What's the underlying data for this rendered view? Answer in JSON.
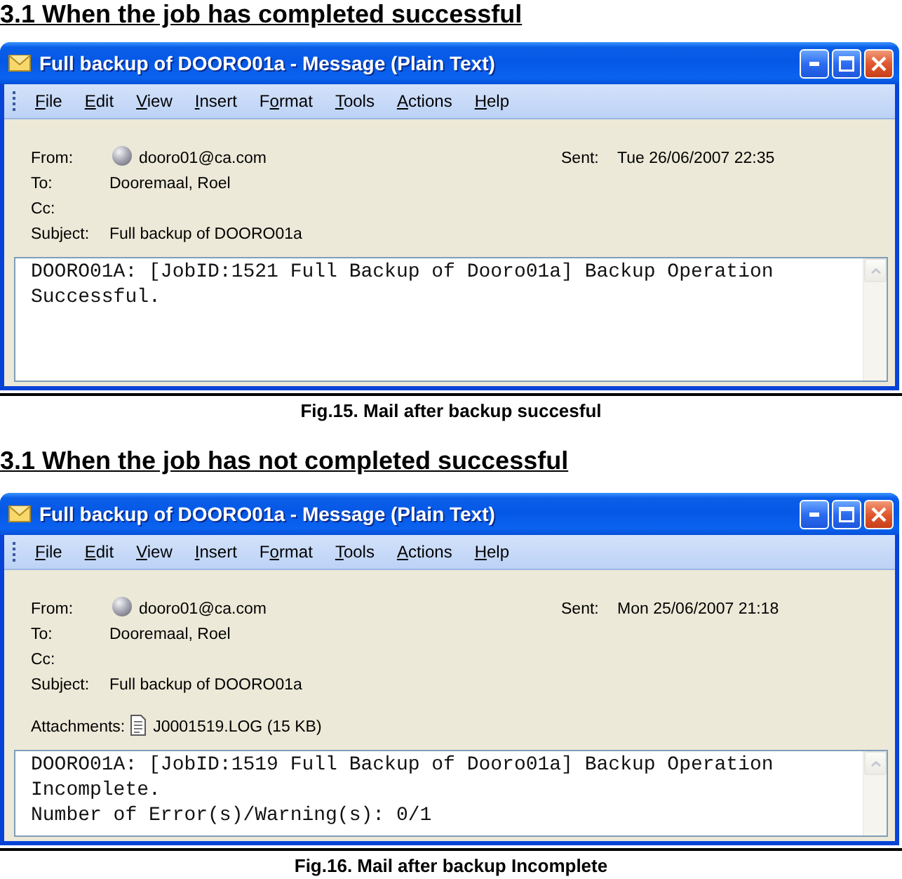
{
  "sections": [
    {
      "heading": "3.1 When the job has completed successful",
      "window": {
        "title": "Full backup of DOORO01a - Message (Plain Text)",
        "menu": [
          {
            "parts": [
              {
                "text": "F",
                "underlined": true
              },
              {
                "text": "ile",
                "underlined": false
              }
            ]
          },
          {
            "parts": [
              {
                "text": "E",
                "underlined": true
              },
              {
                "text": "dit",
                "underlined": false
              }
            ]
          },
          {
            "parts": [
              {
                "text": "V",
                "underlined": true
              },
              {
                "text": "iew",
                "underlined": false
              }
            ]
          },
          {
            "parts": [
              {
                "text": "I",
                "underlined": true
              },
              {
                "text": "nsert",
                "underlined": false
              }
            ]
          },
          {
            "parts": [
              {
                "text": "F",
                "underlined": false
              },
              {
                "text": "o",
                "underlined": true
              },
              {
                "text": "rmat",
                "underlined": false
              }
            ]
          },
          {
            "parts": [
              {
                "text": "T",
                "underlined": true
              },
              {
                "text": "ools",
                "underlined": false
              }
            ]
          },
          {
            "parts": [
              {
                "text": "A",
                "underlined": true
              },
              {
                "text": "ctions",
                "underlined": false
              }
            ]
          },
          {
            "parts": [
              {
                "text": "H",
                "underlined": true
              },
              {
                "text": "elp",
                "underlined": false
              }
            ]
          }
        ],
        "fields": [
          {
            "kind": "sender",
            "label": "From:",
            "value": "dooro01@ca.com"
          },
          {
            "kind": "text",
            "label": "To:",
            "value": "Dooremaal, Roel"
          },
          {
            "kind": "text",
            "label": "Cc:"
          },
          {
            "kind": "text",
            "label": "Subject:",
            "value": "Full backup of DOORO01a"
          }
        ],
        "sent": {
          "label": "Sent:",
          "value": "Tue 26/06/2007 22:35"
        },
        "body": [
          "DOORO01A: [JobID:1521 Full Backup of Dooro01a] Backup Operation Successful."
        ]
      },
      "caption": "Fig.15. Mail after backup succesful"
    },
    {
      "heading": "3.1 When the job has not completed successful",
      "window": {
        "title": "Full backup of DOORO01a - Message (Plain Text)",
        "menu": [
          {
            "parts": [
              {
                "text": "F",
                "underlined": true
              },
              {
                "text": "ile",
                "underlined": false
              }
            ]
          },
          {
            "parts": [
              {
                "text": "E",
                "underlined": true
              },
              {
                "text": "dit",
                "underlined": false
              }
            ]
          },
          {
            "parts": [
              {
                "text": "V",
                "underlined": true
              },
              {
                "text": "iew",
                "underlined": false
              }
            ]
          },
          {
            "parts": [
              {
                "text": "I",
                "underlined": true
              },
              {
                "text": "nsert",
                "underlined": false
              }
            ]
          },
          {
            "parts": [
              {
                "text": "F",
                "underlined": false
              },
              {
                "text": "o",
                "underlined": true
              },
              {
                "text": "rmat",
                "underlined": false
              }
            ]
          },
          {
            "parts": [
              {
                "text": "T",
                "underlined": true
              },
              {
                "text": "ools",
                "underlined": false
              }
            ]
          },
          {
            "parts": [
              {
                "text": "A",
                "underlined": true
              },
              {
                "text": "ctions",
                "underlined": false
              }
            ]
          },
          {
            "parts": [
              {
                "text": "H",
                "underlined": true
              },
              {
                "text": "elp",
                "underlined": false
              }
            ]
          }
        ],
        "fields": [
          {
            "kind": "sender",
            "label": "From:",
            "value": "dooro01@ca.com"
          },
          {
            "kind": "text",
            "label": "To:",
            "value": "Dooremaal, Roel"
          },
          {
            "kind": "text",
            "label": "Cc:"
          },
          {
            "kind": "text",
            "label": "Subject:",
            "value": "Full backup of DOORO01a"
          },
          {
            "kind": "attachment",
            "label": "Attachments:",
            "value": "J0001519.LOG (15 KB)"
          }
        ],
        "sent": {
          "label": "Sent:",
          "value": "Mon 25/06/2007 21:18"
        },
        "body": [
          "DOORO01A: [JobID:1519 Full Backup of Dooro01a] Backup Operation Incomplete.",
          "Number of Error(s)/Warning(s): 0/1"
        ]
      },
      "caption": "Fig.16. Mail after backup Incomplete"
    }
  ]
}
